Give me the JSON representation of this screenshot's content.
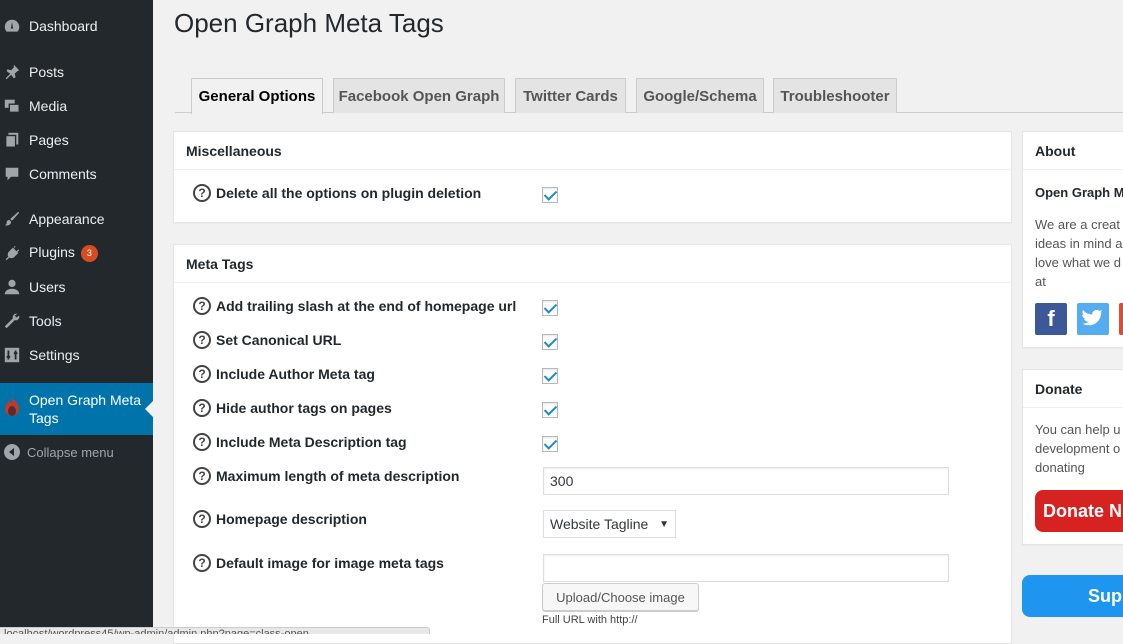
{
  "sidebar": {
    "items": [
      {
        "label": "Dashboard",
        "icon": "dashboard-icon"
      },
      {
        "label": "Posts",
        "icon": "pin-icon"
      },
      {
        "label": "Media",
        "icon": "media-icon"
      },
      {
        "label": "Pages",
        "icon": "pages-icon"
      },
      {
        "label": "Comments",
        "icon": "comment-icon"
      },
      {
        "label": "Appearance",
        "icon": "brush-icon"
      },
      {
        "label": "Plugins",
        "icon": "plugin-icon",
        "badge": "3"
      },
      {
        "label": "Users",
        "icon": "user-icon"
      },
      {
        "label": "Tools",
        "icon": "wrench-icon"
      },
      {
        "label": "Settings",
        "icon": "settings-icon"
      },
      {
        "label": "Open Graph Meta Tags",
        "icon": "og-logo-icon"
      }
    ],
    "collapse_label": "Collapse menu"
  },
  "page_title": "Open Graph Meta Tags",
  "tabs": [
    "General Options",
    "Facebook Open Graph",
    "Twitter Cards",
    "Google/Schema",
    "Troubleshooter"
  ],
  "misc": {
    "title": "Miscellaneous",
    "delete_label": "Delete all the options on plugin deletion"
  },
  "meta": {
    "title": "Meta Tags",
    "rows": [
      "Add trailing slash at the end of homepage url",
      "Set Canonical URL",
      "Include Author Meta tag",
      "Hide author tags on pages",
      "Include Meta Description tag",
      "Maximum length of meta description",
      "Homepage description",
      "Default image for image meta tags"
    ],
    "max_length_value": "300",
    "homepage_desc_selected": "Website Tagline",
    "default_image_value": "",
    "upload_button": "Upload/Choose image",
    "url_hint": "Full URL with http://"
  },
  "about": {
    "title": "About",
    "plugin_name": "Open Graph M",
    "text_lines": [
      "We are a creat",
      "ideas in mind a",
      "love what we d",
      "at"
    ]
  },
  "donate": {
    "title": "Donate",
    "text_lines": [
      "You can help u",
      "development o",
      "donating"
    ],
    "button": "Donate N"
  },
  "support_button": "Supp",
  "status_url": "localhost/wordpress45/wp-admin/admin.php?page=class-open..."
}
